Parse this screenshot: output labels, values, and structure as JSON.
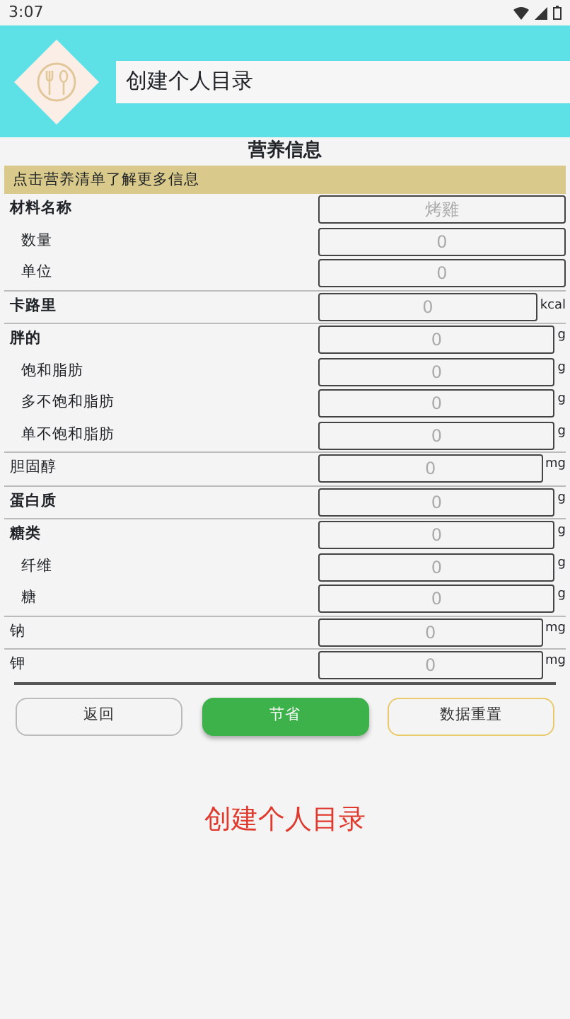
{
  "status_bar": {
    "time": "3:07"
  },
  "header": {
    "title": "创建个人目录"
  },
  "section_title": "营养信息",
  "banner": "点击营养清单了解更多信息",
  "groups": [
    {
      "rows": [
        {
          "label": "材料名称",
          "kind": "main",
          "placeholder": "烤雞"
        },
        {
          "label": "数量",
          "kind": "sub",
          "placeholder": "0"
        },
        {
          "label": "单位",
          "kind": "sub",
          "placeholder": "0"
        }
      ]
    },
    {
      "rows": [
        {
          "label": "卡路里",
          "kind": "main",
          "placeholder": "0",
          "unit": "kcal"
        }
      ]
    },
    {
      "rows": [
        {
          "label": "胖的",
          "kind": "main",
          "placeholder": "0",
          "unit": "g"
        },
        {
          "label": "饱和脂肪",
          "kind": "sub",
          "placeholder": "0",
          "unit": "g"
        },
        {
          "label": "多不饱和脂肪",
          "kind": "sub",
          "placeholder": "0",
          "unit": "g"
        },
        {
          "label": "单不饱和脂肪",
          "kind": "sub",
          "placeholder": "0",
          "unit": "g"
        }
      ]
    },
    {
      "rows": [
        {
          "label": "胆固醇",
          "kind": "plain",
          "placeholder": "0",
          "unit": "mg"
        }
      ]
    },
    {
      "rows": [
        {
          "label": "蛋白质",
          "kind": "main",
          "placeholder": "0",
          "unit": "g"
        }
      ]
    },
    {
      "rows": [
        {
          "label": "糖类",
          "kind": "main",
          "placeholder": "0",
          "unit": "g"
        },
        {
          "label": "纤维",
          "kind": "sub",
          "placeholder": "0",
          "unit": "g"
        },
        {
          "label": "糖",
          "kind": "sub",
          "placeholder": "0",
          "unit": "g"
        }
      ]
    },
    {
      "rows": [
        {
          "label": "钠",
          "kind": "plain",
          "placeholder": "0",
          "unit": "mg"
        }
      ]
    },
    {
      "rows": [
        {
          "label": "钾",
          "kind": "plain",
          "placeholder": "0",
          "unit": "mg"
        }
      ]
    }
  ],
  "buttons": [
    {
      "label": "返回",
      "kind": "outline"
    },
    {
      "label": "节省",
      "kind": "primary"
    },
    {
      "label": "数据重置",
      "kind": "warning"
    }
  ],
  "footer_text": "创建个人目录"
}
